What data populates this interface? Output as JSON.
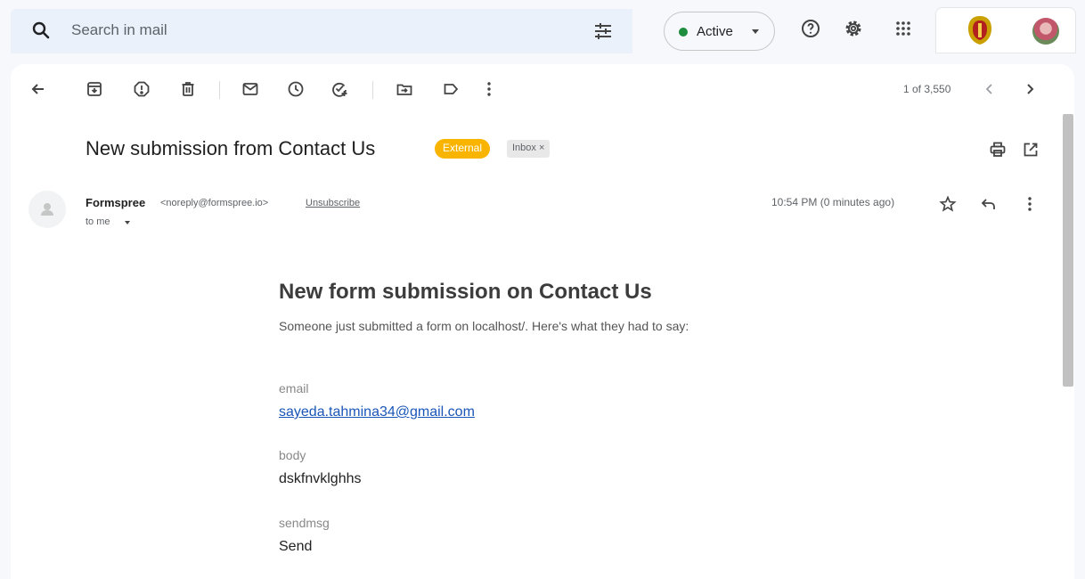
{
  "search": {
    "placeholder": "Search in mail",
    "icon": "search-icon",
    "filter_icon": "tune-icon"
  },
  "status": {
    "label": "Active",
    "color": "#1e8e3e"
  },
  "header_icons": [
    "help-icon",
    "settings-icon",
    "apps-icon"
  ],
  "toolbar": {
    "icons": [
      "back-arrow-icon",
      "archive-icon",
      "report-spam-icon",
      "delete-icon",
      "mark-unread-icon",
      "snooze-icon",
      "add-task-icon",
      "move-to-icon",
      "label-icon",
      "more-options-icon"
    ],
    "pager": "1 of 3,550"
  },
  "email": {
    "subject": "New submission from Contact Us",
    "labels": {
      "external": "External",
      "inbox": "Inbox",
      "inbox_close": "×"
    },
    "sender_name": "Formspree",
    "sender_email": "<noreply@formspree.io>",
    "unsubscribe": "Unsubscribe",
    "to": "to me",
    "time": "10:54 PM (0 minutes ago)"
  },
  "body": {
    "title": "New form submission on Contact Us",
    "intro": "Someone just submitted a form on localhost/. Here's what they had to say:",
    "fields": [
      {
        "label": "email",
        "value": "sayeda.tahmina34@gmail.com"
      },
      {
        "label": "body",
        "value": "dskfnvklghhs"
      },
      {
        "label": "sendmsg",
        "value": "Send"
      }
    ]
  },
  "colors": {
    "external_badge": "#f9b400",
    "link": "#1a55b8",
    "panel_bg": "#ffffff",
    "page_bg": "#f6f8fc"
  }
}
